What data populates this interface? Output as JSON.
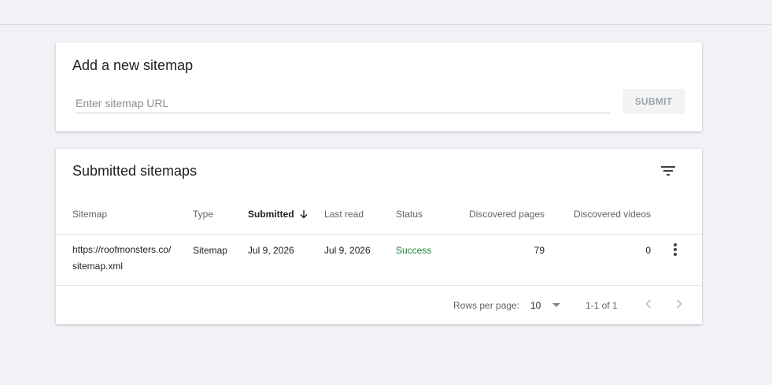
{
  "add_sitemap": {
    "title": "Add a new sitemap",
    "input_placeholder": "Enter sitemap URL",
    "input_value": "",
    "submit_label": "SUBMIT"
  },
  "submitted": {
    "title": "Submitted sitemaps",
    "filter_icon": "filter-list-icon",
    "columns": {
      "sitemap": "Sitemap",
      "type": "Type",
      "submitted": "Submitted",
      "last_read": "Last read",
      "status": "Status",
      "discovered_pages": "Discovered pages",
      "discovered_videos": "Discovered videos"
    },
    "sort": {
      "column": "submitted",
      "direction": "descending",
      "icon": "arrow-down-icon"
    },
    "rows": [
      {
        "sitemap": "https://roofmonsters.co/ sitemap.xml",
        "type": "Sitemap",
        "submitted": "Jul 9, 2026",
        "last_read": "Jul 9, 2026",
        "status": "Success",
        "discovered_pages": "79",
        "discovered_videos": "0"
      }
    ],
    "footer": {
      "rows_per_page_label": "Rows per page:",
      "rows_per_page_value": "10",
      "range": "1-1 of 1"
    }
  },
  "colors": {
    "page_background": "#f0f2f6",
    "card_background": "#ffffff",
    "success": "#188038",
    "disabled_button": "#f1f3f4"
  }
}
